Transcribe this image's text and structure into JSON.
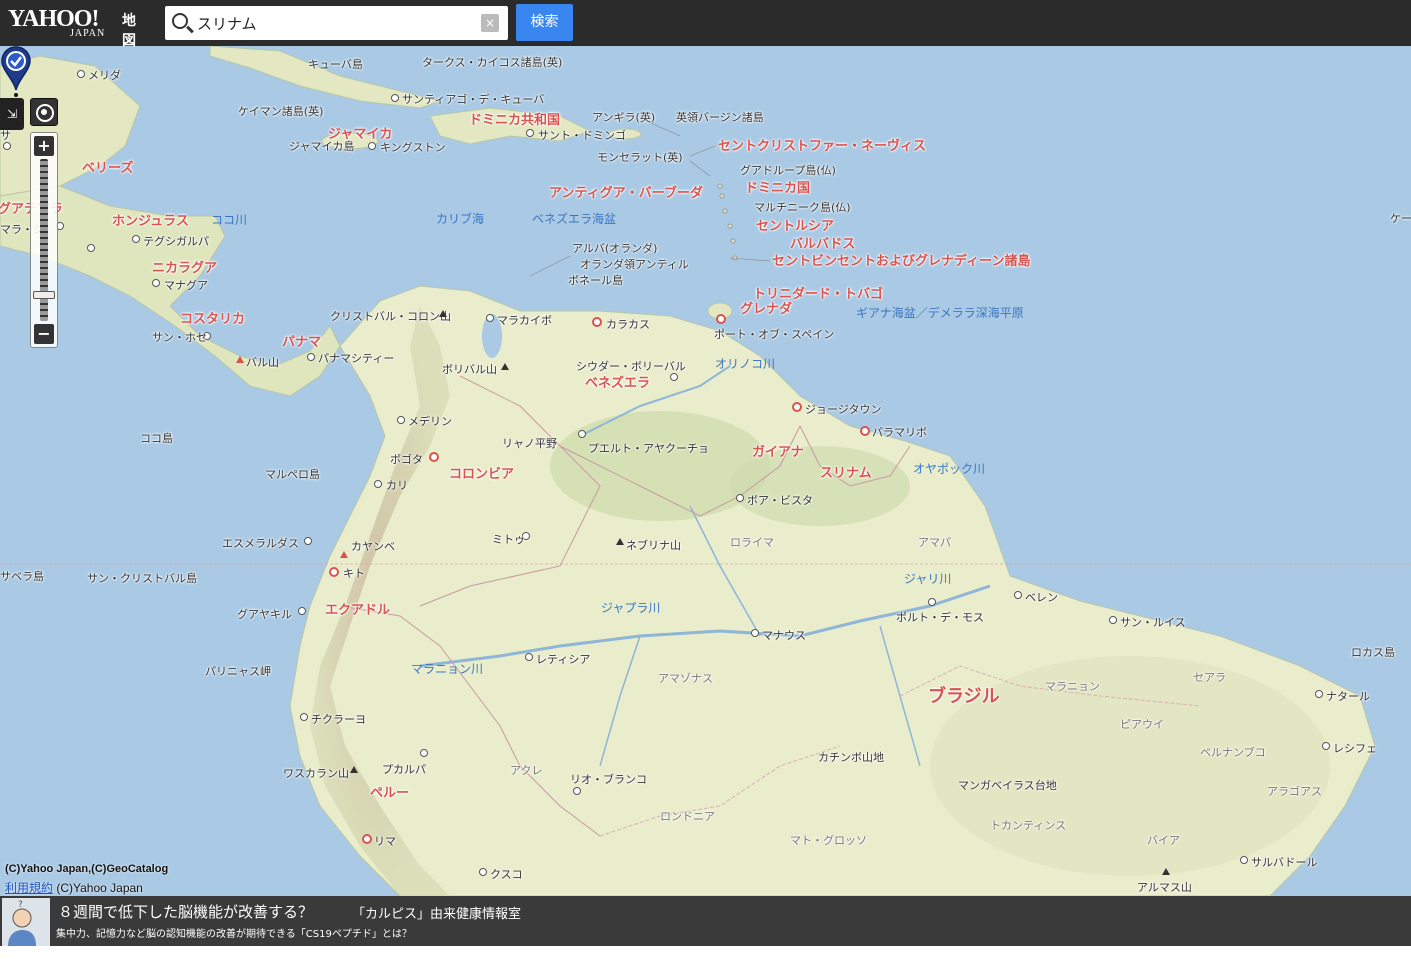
{
  "header": {
    "logo_main": "YAHOO!",
    "logo_sub": "JAPAN",
    "logo_service": "地図",
    "search_value": "スリナム",
    "clear_label": "×",
    "search_button": "検索"
  },
  "controls": {
    "toggle_label": "⇲",
    "zoom_in": "+",
    "zoom_out": "−",
    "zoom_level_fraction": 0.16
  },
  "map": {
    "selected_marker": "スリナム",
    "countries": [
      {
        "name": "ジャマイカ"
      },
      {
        "name": "ドミニカ共和国"
      },
      {
        "name": "ベリーズ"
      },
      {
        "name": "ホンジュラス"
      },
      {
        "name": "ニカラグア"
      },
      {
        "name": "コスタリカ"
      },
      {
        "name": "パナマ"
      },
      {
        "name": "グアテマラ"
      },
      {
        "name": "セントクリストファー・ネーヴィス"
      },
      {
        "name": "アンティグア・バーブーダ"
      },
      {
        "name": "ドミニカ国"
      },
      {
        "name": "セントルシア"
      },
      {
        "name": "バルバドス"
      },
      {
        "name": "セントビンセントおよびグレナディーン諸島"
      },
      {
        "name": "トリニダード・トバゴ"
      },
      {
        "name": "グレナダ"
      },
      {
        "name": "ベネズエラ"
      },
      {
        "name": "コロンビア"
      },
      {
        "name": "ガイアナ"
      },
      {
        "name": "スリナム"
      },
      {
        "name": "エクアドル"
      },
      {
        "name": "ペルー"
      },
      {
        "name": "ブラジル"
      }
    ],
    "cities": [
      {
        "name": "メリダ"
      },
      {
        "name": "サンティアゴ・デ・キューバ"
      },
      {
        "name": "キングストン"
      },
      {
        "name": "サント・ドミンゴ"
      },
      {
        "name": "テグシガルパ"
      },
      {
        "name": "マナグア"
      },
      {
        "name": "サン・ホセ"
      },
      {
        "name": "パナマシティー"
      },
      {
        "name": "マラカイボ"
      },
      {
        "name": "カラカス"
      },
      {
        "name": "ポート・オブ・スペイン"
      },
      {
        "name": "シウダー・ボリーバル"
      },
      {
        "name": "メデリン"
      },
      {
        "name": "ボゴタ"
      },
      {
        "name": "カリ"
      },
      {
        "name": "ジョージタウン"
      },
      {
        "name": "パラマリボ"
      },
      {
        "name": "プエルト・アヤクーチョ"
      },
      {
        "name": "ボア・ビスタ"
      },
      {
        "name": "ミトゥ"
      },
      {
        "name": "キト"
      },
      {
        "name": "グアヤキル"
      },
      {
        "name": "ベレン"
      },
      {
        "name": "サン・ルイス"
      },
      {
        "name": "マナウス"
      },
      {
        "name": "ポルト・デ・モス"
      },
      {
        "name": "レティシア"
      },
      {
        "name": "ナタール"
      },
      {
        "name": "レシフェ"
      },
      {
        "name": "チクラーヨ"
      },
      {
        "name": "プカルパ"
      },
      {
        "name": "リオ・ブランコ"
      },
      {
        "name": "リマ"
      },
      {
        "name": "クスコ"
      },
      {
        "name": "サルバドール"
      },
      {
        "name": "エスメラルダス"
      }
    ],
    "features": [
      {
        "name": "キューバ島"
      },
      {
        "name": "タークス・カイコス諸島(英)"
      },
      {
        "name": "ケイマン諸島(英)"
      },
      {
        "name": "ジャマイカ島"
      },
      {
        "name": "アンギラ(英)"
      },
      {
        "name": "英領バージン諸島"
      },
      {
        "name": "モンセラット(英)"
      },
      {
        "name": "グアドループ島(仏)"
      },
      {
        "name": "マルチニーク島(仏)"
      },
      {
        "name": "アルバ(オランダ)"
      },
      {
        "name": "オランダ領アンティル"
      },
      {
        "name": "ボネール島"
      },
      {
        "name": "クリストバル・コロン山"
      },
      {
        "name": "ボリバル山"
      },
      {
        "name": "バル山"
      },
      {
        "name": "リャノ平野"
      },
      {
        "name": "ネブリナ山"
      },
      {
        "name": "カヤンベ"
      },
      {
        "name": "ココ島"
      },
      {
        "name": "マルペロ島"
      },
      {
        "name": "サン・クリストバル島"
      },
      {
        "name": "パリニャス岬"
      },
      {
        "name": "ワスカラン山"
      },
      {
        "name": "カチンボ山地"
      },
      {
        "name": "マンガベイラス台地"
      },
      {
        "name": "アルマス山"
      },
      {
        "name": "ロカス島"
      },
      {
        "name": "サベラ島"
      }
    ],
    "waters": [
      {
        "name": "カリブ海"
      },
      {
        "name": "ベネズエラ海盆"
      },
      {
        "name": "ココ川"
      },
      {
        "name": "ギアナ海盆／デメララ深海平原"
      },
      {
        "name": "オリノコ川"
      },
      {
        "name": "オヤポック川"
      },
      {
        "name": "ジャリ川"
      },
      {
        "name": "ジャプラ川"
      },
      {
        "name": "マラニョン川"
      }
    ],
    "regions": [
      {
        "name": "アマパ"
      },
      {
        "name": "ロライマ"
      },
      {
        "name": "アマゾナス"
      },
      {
        "name": "マラニョン"
      },
      {
        "name": "ピアウイ"
      },
      {
        "name": "セアラ"
      },
      {
        "name": "ペルナンブコ"
      },
      {
        "name": "アラゴアス"
      },
      {
        "name": "バイア"
      },
      {
        "name": "トカンティンス"
      },
      {
        "name": "マト・グロッソ"
      },
      {
        "name": "ロンドニア"
      },
      {
        "name": "アクレ"
      }
    ],
    "edge_labels": [
      {
        "name": "ケー"
      },
      {
        "name": "マラ・シ"
      },
      {
        "name": "サ"
      }
    ]
  },
  "copyright": {
    "line1": "(C)Yahoo Japan,(C)GeoCatalog",
    "terms_link": "利用規約",
    "line2": "(C)Yahoo Japan"
  },
  "ad": {
    "title": "８週間で低下した脳機能が改善する？",
    "source": "「カルピス」由来健康情報室",
    "description": "集中力、記憶力など脳の認知機能の改善が期待できる「CS19ペプチド」とは？"
  },
  "colors": {
    "sea": "#a9c9e4",
    "land": "#e9edcc",
    "country_label": "#d9534f",
    "water_label": "#3b78c4",
    "header_bg": "#2b2b2b",
    "search_button": "#3a86f0"
  }
}
